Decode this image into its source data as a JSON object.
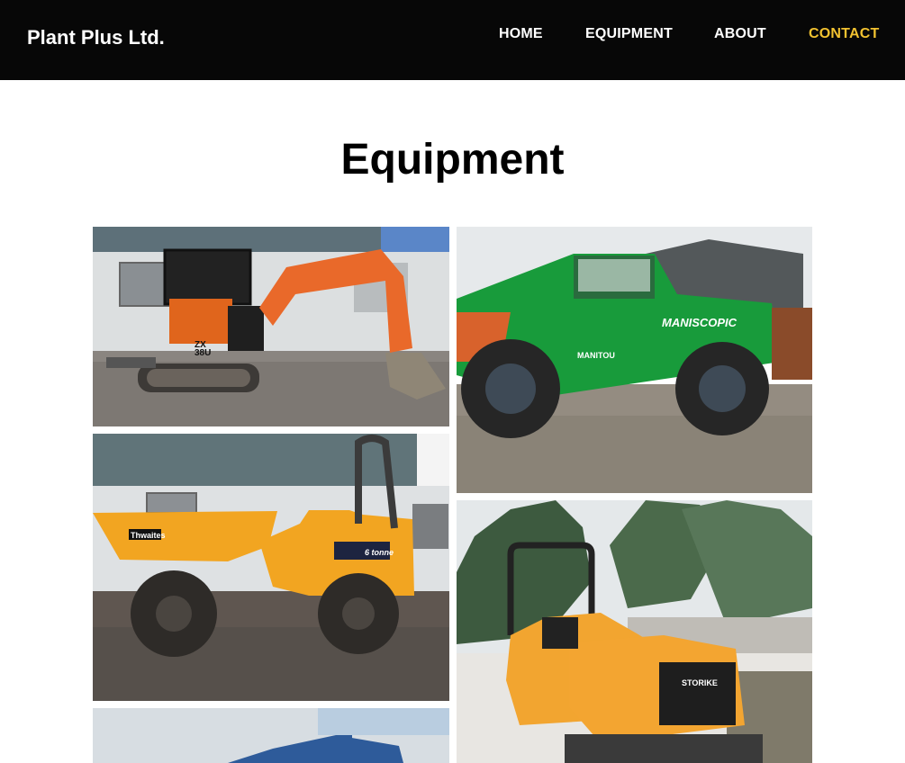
{
  "header": {
    "brand": "Plant Plus Ltd.",
    "nav": [
      {
        "label": "HOME"
      },
      {
        "label": "EQUIPMENT"
      },
      {
        "label": "ABOUT"
      },
      {
        "label": "CONTACT",
        "active": true
      }
    ],
    "colors": {
      "background": "#070707",
      "text": "#ffffff",
      "active": "#f2c230"
    }
  },
  "main": {
    "title": "Equipment",
    "gallery": [
      {
        "subject": "mini excavator",
        "text": [
          "ZX",
          "38U"
        ]
      },
      {
        "subject": "telehandler",
        "text": [
          "MANISCOPIC",
          "MANITOU"
        ]
      },
      {
        "subject": "site dumper",
        "text": [
          "Thwaites",
          "6 tonne"
        ]
      },
      {
        "subject": "roller",
        "text": [
          "STORIKE"
        ]
      },
      {
        "subject": "building"
      }
    ]
  }
}
